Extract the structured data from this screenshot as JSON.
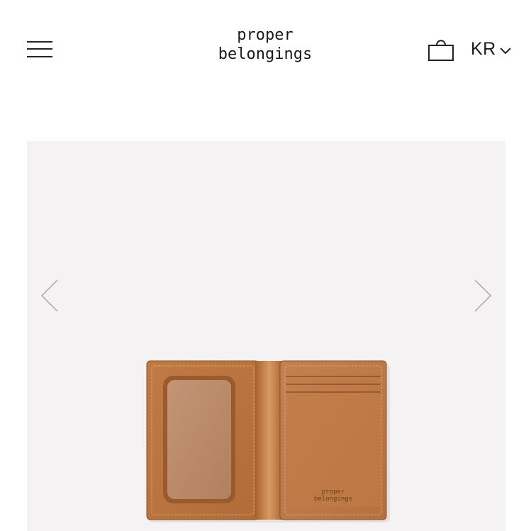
{
  "header": {
    "logo_line1": "proper",
    "logo_line2": "belongings",
    "language": "KR",
    "menu_icon": "hamburger-menu-icon",
    "cart_icon": "shopping-bag-icon",
    "language_chevron_icon": "chevron-down-icon"
  },
  "gallery": {
    "background": "#f4f2f2",
    "prev_icon": "chevron-left-icon",
    "next_icon": "chevron-right-icon",
    "product_image": {
      "imprint_line1": "proper",
      "imprint_line2": "belongings",
      "leather_color": "#b8743f"
    }
  }
}
